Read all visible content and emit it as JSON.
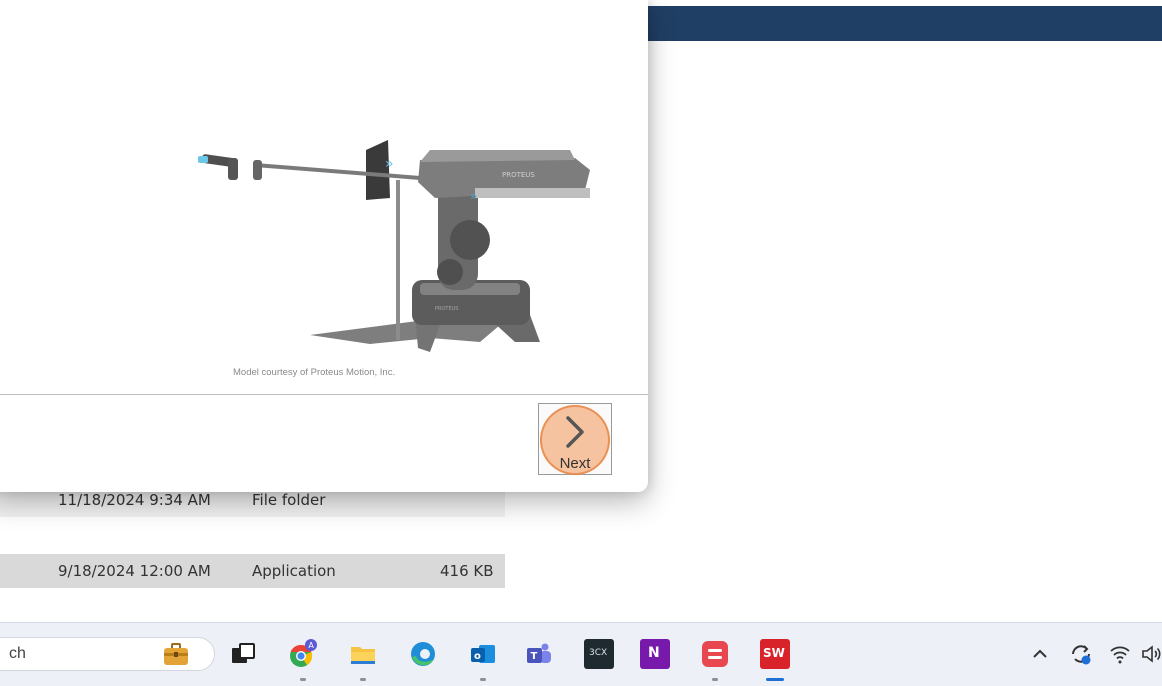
{
  "dialog": {
    "caption": "Model courtesy of Proteus Motion, Inc.",
    "robot_brand": "PROTEUS",
    "next_label": "Next"
  },
  "explorer": {
    "rows": [
      {
        "date": "11/18/2024 9:34 AM",
        "type": "File folder",
        "size": ""
      },
      {
        "date": "9/18/2024 12:00 AM",
        "type": "Application",
        "size": "416 KB"
      }
    ]
  },
  "taskbar": {
    "search_text": "ch",
    "apps": [
      {
        "name": "briefcase-icon"
      },
      {
        "name": "task-view-icon"
      },
      {
        "name": "chrome-icon"
      },
      {
        "name": "file-explorer-icon"
      },
      {
        "name": "edge-icon"
      },
      {
        "name": "outlook-icon"
      },
      {
        "name": "teams-icon"
      },
      {
        "name": "3cx-icon",
        "label": "3CX"
      },
      {
        "name": "onenote-icon",
        "label": "N"
      },
      {
        "name": "red-app-icon"
      },
      {
        "name": "solidworks-icon",
        "label": "SW"
      }
    ],
    "tray": [
      "chevron-up-icon",
      "sync-icon",
      "wifi-icon",
      "speaker-icon"
    ]
  },
  "colors": {
    "topbar": "#203f64",
    "highlight": "#f4b082",
    "taskbar_bg": "#eef0f7",
    "active_indicator": "#1f6fd6"
  }
}
